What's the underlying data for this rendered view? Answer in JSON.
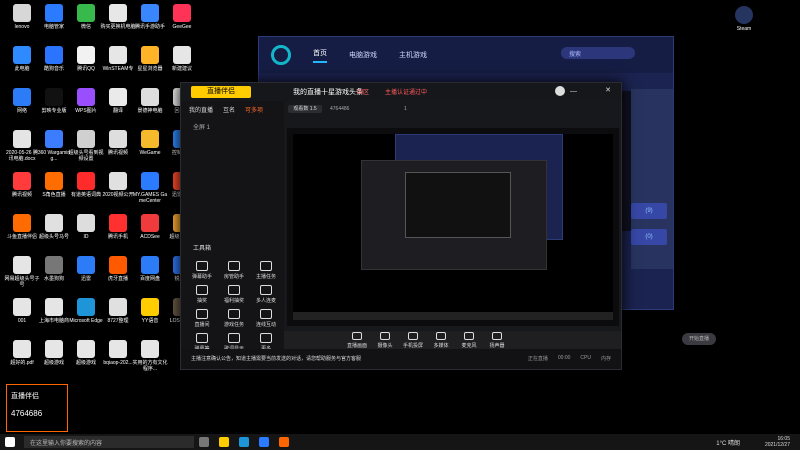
{
  "desktop_icons": [
    {
      "label": "lenovo",
      "color": "#d7d7d7"
    },
    {
      "label": "电脑管家",
      "color": "#2a7bff"
    },
    {
      "label": "微信",
      "color": "#37b94b"
    },
    {
      "label": "购买更换机电脑",
      "color": "#e7e7e7"
    },
    {
      "label": "腾讯手游助手",
      "color": "#3a86ff"
    },
    {
      "label": "GeeGee",
      "color": "#ff3355"
    },
    {
      "label": "此电脑",
      "color": "#2f89ff"
    },
    {
      "label": "酷狗音乐",
      "color": "#2b74ff"
    },
    {
      "label": "腾讯QQ",
      "color": "#f2f2f2"
    },
    {
      "label": "WinSTEAM专",
      "color": "#e6e6e6"
    },
    {
      "label": "星星浏览器",
      "color": "#ffb428"
    },
    {
      "label": "新建建议",
      "color": "#e6e6e6"
    },
    {
      "label": "网络",
      "color": "#2c7cf8"
    },
    {
      "label": "剪映专业版",
      "color": "#111"
    },
    {
      "label": "WPS图片",
      "color": "#9a4fff"
    },
    {
      "label": "翻译",
      "color": "#eaeaea"
    },
    {
      "label": "景德神电脑",
      "color": "#ddd"
    },
    {
      "label": "回收站",
      "color": "#f0f0f0"
    },
    {
      "label": "2020-05-26 腾讯电脑.docx",
      "color": "#e5e5e5"
    },
    {
      "label": "360 Wargaming...",
      "color": "#3c7dff"
    },
    {
      "label": "超级头号看到视频设置",
      "color": "#d0d0d0"
    },
    {
      "label": "腾讯视频",
      "color": "#dedede"
    },
    {
      "label": "WeGame",
      "color": "#f6b92c"
    },
    {
      "label": "控制面板",
      "color": "#2e89ff"
    },
    {
      "label": "腾讯视频",
      "color": "#ff3b3b"
    },
    {
      "label": "S角色直播",
      "color": "#ff6d00"
    },
    {
      "label": "有道英语词典",
      "color": "#ff2b2b"
    },
    {
      "label": "2020视频公开",
      "color": "#e0e0e0"
    },
    {
      "label": "MY.GAMES GameCenter",
      "color": "#2a7bff"
    },
    {
      "label": "迅雷阵式",
      "color": "#ff4b2b"
    },
    {
      "label": "斗鱼直播伴侣",
      "color": "#ff6b00"
    },
    {
      "label": "超级头号马号",
      "color": "#e0e0e0"
    },
    {
      "label": "ID",
      "color": "#ddd"
    },
    {
      "label": "腾讯手机",
      "color": "#ff3030"
    },
    {
      "label": "ACDSee",
      "color": "#ef3b3b"
    },
    {
      "label": "超级头手场",
      "color": "#ffae33"
    },
    {
      "label": "网易超级头号子号",
      "color": "#e5e5e5"
    },
    {
      "label": "水墨狗狗",
      "color": "#777"
    },
    {
      "label": "迅雷",
      "color": "#2c7cf8"
    },
    {
      "label": "虎牙直播",
      "color": "#ff5a00"
    },
    {
      "label": "百度网盘",
      "color": "#2c7cf8"
    },
    {
      "label": "锐大师",
      "color": "#2e7bff"
    },
    {
      "label": "001",
      "color": "#e5e5e5"
    },
    {
      "label": "上海市电脑商",
      "color": "#e5e5e5"
    },
    {
      "label": "Microsoft Edge",
      "color": "#1d95d8"
    },
    {
      "label": "8727整理",
      "color": "#e0e0e0"
    },
    {
      "label": "YY语音",
      "color": "#ffcc00"
    },
    {
      "label": "LOST ARK",
      "color": "#6b5b45"
    },
    {
      "label": "超好的.pdf",
      "color": "#e6e6e6"
    },
    {
      "label": "超级游戏",
      "color": "#e6e6e6"
    },
    {
      "label": "超级游戏",
      "color": "#e6e6e6"
    },
    {
      "label": "bqiaop-202...",
      "color": "#e6e6e6"
    },
    {
      "label": "实用的方有文化程序...",
      "color": "#e6e6e6"
    }
  ],
  "steam": {
    "label": "Steam"
  },
  "background_window": {
    "tabs": [
      "首页",
      "电脑游戏",
      "主机游戏"
    ],
    "search": "搜索",
    "side_texts": [
      "(9)",
      "(0)"
    ]
  },
  "main_window": {
    "title": "直播伴侣",
    "sidebar_tabs": [
      "我的直播",
      "互名",
      "可多项"
    ],
    "scene": "全屏 1",
    "toolbox": "工具箱",
    "tools": [
      {
        "label": "弹幕助手"
      },
      {
        "label": "房管助手"
      },
      {
        "label": "主播任务"
      },
      {
        "label": "抽奖"
      },
      {
        "label": "福利抽奖"
      },
      {
        "label": "多人连麦"
      },
      {
        "label": "直播间"
      },
      {
        "label": "游戏任务"
      },
      {
        "label": "连线互动"
      },
      {
        "label": "弹幕等"
      },
      {
        "label": "歌词显示"
      },
      {
        "label": "更多"
      }
    ],
    "header_title": "我的直播十星游戏头条",
    "header_badge": "国区",
    "header_status": "主播认证通过中",
    "meta": [
      "观看数 1.5",
      "4764486",
      "1"
    ],
    "buttons": [
      "直播画面",
      "摄像头",
      "手机投屏",
      "多媒体",
      "麦克风",
      "扬声器"
    ],
    "go_live": "开始直播",
    "status": "主播注意确认公告，知道主播需要当前发送的对话，请您帮助服务与官方客服",
    "bottom_right": [
      "正在直播",
      "00:00",
      "CPU",
      "内存"
    ]
  },
  "overlay": {
    "brand": "直播伴侣",
    "id": "4764686"
  },
  "taskbar": {
    "search_placeholder": "在这里输入你要搜索的内容",
    "temp": "1°C",
    "weather": "晴朗",
    "time": "16:05",
    "date": "2021/12/27"
  }
}
